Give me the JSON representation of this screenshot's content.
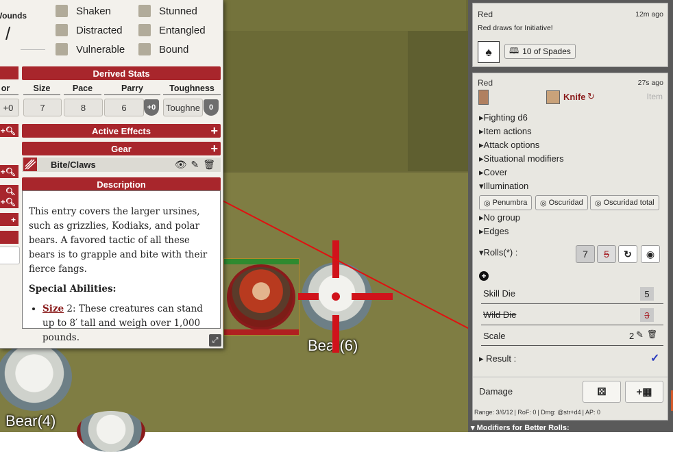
{
  "sheet": {
    "wounds_label": "Wounds",
    "wounds_value": "/",
    "conditions": [
      "Shaken",
      "Stunned",
      "Distracted",
      "Entangled",
      "Vulnerable",
      "Bound"
    ],
    "derived_stats_title": "Derived Stats",
    "stats": [
      {
        "label": "or",
        "value": "+0"
      },
      {
        "label": "Size",
        "value": "7"
      },
      {
        "label": "Pace",
        "value": "8"
      },
      {
        "label": "Parry",
        "value": "6",
        "mod": "+0"
      },
      {
        "label": "Toughness",
        "value": "Toughne",
        "mod": "0"
      }
    ],
    "active_effects_title": "Active Effects",
    "gear_title": "Gear",
    "item_name": "Bite/Claws",
    "description_title": "Description",
    "description_p1": "This entry covers the larger ursines, such as grizzlies, Kodiaks, and polar bears. A favored tactic of all these bears is to grapple and bite with their fierce fangs.",
    "special_abilities": "Special Abilities:",
    "ability_link": "Size",
    "ability_rest": " 2: These creatures can stand up to 8′ tall and weigh over 1,000 pounds."
  },
  "tokens": {
    "bear6": "Bear(6)",
    "bear4": "Bear(4)"
  },
  "chat": {
    "msg1": {
      "who": "Red",
      "when": "12m ago",
      "text": "Red draws for Initiative!",
      "card": "10 of Spades"
    },
    "msg2": {
      "who": "Red",
      "when": "27s ago",
      "item": "Knife",
      "item_type": "Item",
      "tree": [
        "Fighting d6",
        "Item actions",
        "Attack options",
        "Situational modifiers",
        "Cover"
      ],
      "illumination": "Illumination",
      "light_options": [
        "Penumbra",
        "Oscuridad",
        "Oscuridad total"
      ],
      "tree2": [
        "No group",
        "Edges"
      ],
      "rolls_label": "Rolls(*) :",
      "roll_values": [
        "7",
        "5"
      ],
      "rows": [
        {
          "label": "Skill Die",
          "value": "5"
        },
        {
          "label": "Wild Die",
          "value": "3"
        },
        {
          "label": "Scale",
          "value": "2"
        }
      ],
      "result_label": "Result :",
      "damage_label": "Damage",
      "footer": [
        "Range: 3/6/12",
        "RoF: 0",
        "Dmg: @str+d4",
        "AP: 0"
      ],
      "modifiers": "Modifiers for Better Rolls:"
    }
  },
  "colors": {
    "accent_red": "#a8262c",
    "grass": "#7f7d43"
  }
}
